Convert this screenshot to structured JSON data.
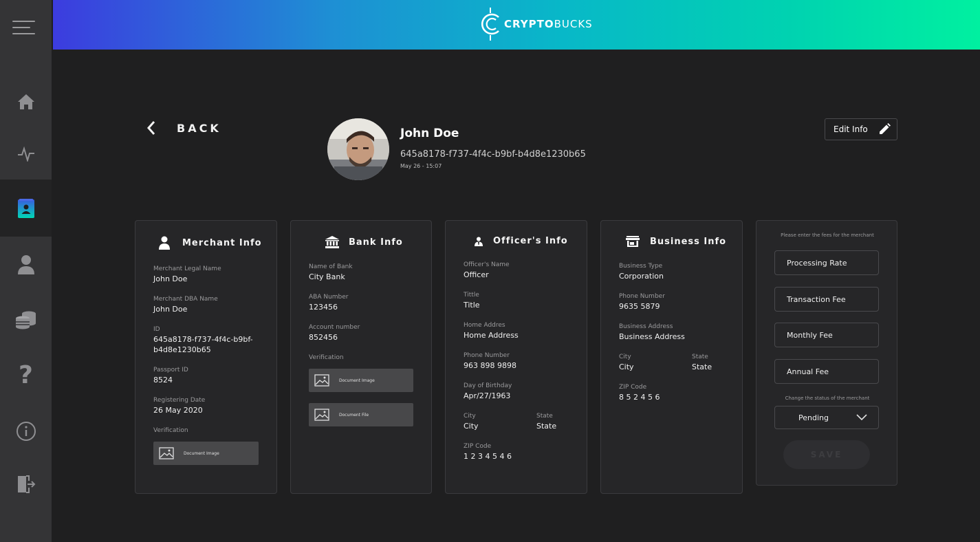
{
  "app": {
    "logo_text_a": "CRYPTO",
    "logo_text_b": "BUCKS"
  },
  "sidebar": {
    "items": [
      {
        "icon": "home-icon"
      },
      {
        "icon": "activity-icon"
      },
      {
        "icon": "merchant-book-icon",
        "active": true
      },
      {
        "icon": "user-icon"
      },
      {
        "icon": "coins-icon"
      },
      {
        "icon": "help-icon"
      },
      {
        "icon": "info-icon"
      },
      {
        "icon": "logout-icon"
      }
    ]
  },
  "nav": {
    "back_label": "BACK"
  },
  "profile": {
    "name": "John Doe",
    "id": "645a8178-f737-4f4c-b9bf-b4d8e1230b65",
    "date": "May 26 - 15:07",
    "edit_label": "Edit Info"
  },
  "merchant": {
    "title": "Merchant Info",
    "legal_name_label": "Merchant Legal Name",
    "legal_name": "John Doe",
    "dba_label": "Merchant DBA Name",
    "dba": "John Doe",
    "id_label": "ID",
    "id_line1": "645a8178-f737-4f4c-b9bf-",
    "id_line2": "b4d8e1230b65",
    "passport_label": "Passport ID",
    "passport": "8524",
    "reg_label": "Registering Date",
    "reg": "26 May 2020",
    "verification_label": "Verification",
    "doc_image": "Document Image"
  },
  "bank": {
    "title": "Bank Info",
    "bank_name_label": "Name of Bank",
    "bank_name": "City Bank",
    "aba_label": "ABA Number",
    "aba": "123456",
    "account_label": "Account number",
    "account": "852456",
    "verification_label": "Verification",
    "doc_image": "Document Image",
    "doc_file": "Document File"
  },
  "officer": {
    "title": "Officer's Info",
    "name_label": "Officer's Name",
    "name": "Officer",
    "title_label": "Tittle",
    "title_val": "Title",
    "home_label": "Home Addres",
    "home": "Home Address",
    "phone_label": "Phone Number",
    "phone": "963 898 9898",
    "birthday_label": "Day of Birthday",
    "birthday": "Apr/27/1963",
    "city_label": "City",
    "city": "City",
    "state_label": "State",
    "state": "State",
    "zip_label": "ZIP Code",
    "zip": "1 2 3 4 5 4 6"
  },
  "business": {
    "title": "Business Info",
    "type_label": "Business Type",
    "type": "Corporation",
    "phone_label": "Phone Number",
    "phone": "9635 5879",
    "address_label": "Business Address",
    "address": "Business Address",
    "city_label": "City",
    "city": "City",
    "state_label": "State",
    "state": "State",
    "zip_label": "ZIP Code",
    "zip": "8 5 2 4 5 6"
  },
  "fees": {
    "note": "Please enter the fees for the merchant",
    "processing_rate": "Processing Rate",
    "transaction_fee": "Transaction Fee",
    "monthly_fee": "Monthly Fee",
    "annual_fee": "Annual Fee",
    "status_note": "Change the status of the merchant",
    "status": "Pending",
    "save_label": "SAVE"
  },
  "colors": {
    "background": "#1f1f20",
    "sidebar": "#343436",
    "card": "#262628",
    "accent_start": "#3c3cdf",
    "accent_end": "#00f0a0"
  }
}
